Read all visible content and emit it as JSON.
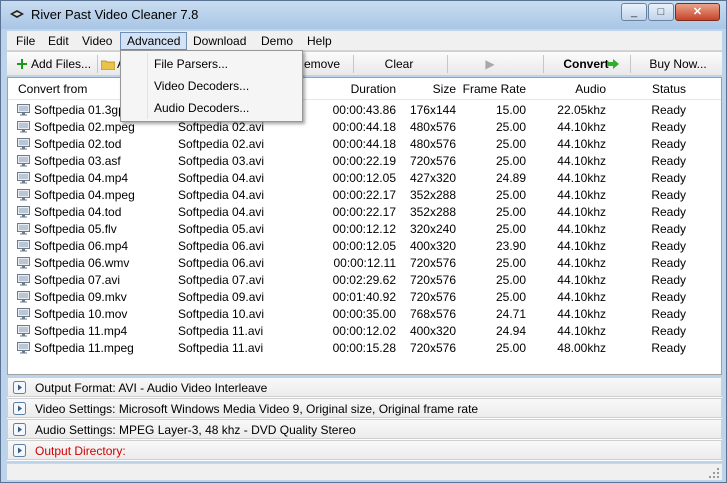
{
  "window": {
    "title": "River Past Video Cleaner 7.8"
  },
  "window_controls": {
    "minimize": "_",
    "maximize": "□",
    "close": "✕"
  },
  "menu": [
    "File",
    "Edit",
    "Video",
    "Advanced",
    "Download",
    "Demo",
    "Help"
  ],
  "advanced_menu": [
    "File Parsers...",
    "Video Decoders...",
    "Audio Decoders..."
  ],
  "toolbar": {
    "add_files": "Add Files...",
    "add_folder": "A",
    "remove": "emove",
    "clear": "Clear",
    "play": "▶",
    "convert": "Convert",
    "buy_now": "Buy Now..."
  },
  "columns": {
    "convert_from": "Convert from",
    "duration": "Duration",
    "size": "Size",
    "frame_rate": "Frame Rate",
    "audio": "Audio",
    "status": "Status"
  },
  "rows": [
    {
      "from": "Softpedia 01.3gp",
      "to": "Softpedia 01.avi",
      "duration": "00:00:43.86",
      "size": "176x144",
      "fps": "15.00",
      "audio": "22.05khz",
      "status": "Ready"
    },
    {
      "from": "Softpedia 02.mpeg",
      "to": "Softpedia 02.avi",
      "duration": "00:00:44.18",
      "size": "480x576",
      "fps": "25.00",
      "audio": "44.10khz",
      "status": "Ready"
    },
    {
      "from": "Softpedia 02.tod",
      "to": "Softpedia 02.avi",
      "duration": "00:00:44.18",
      "size": "480x576",
      "fps": "25.00",
      "audio": "44.10khz",
      "status": "Ready"
    },
    {
      "from": "Softpedia 03.asf",
      "to": "Softpedia 03.avi",
      "duration": "00:00:22.19",
      "size": "720x576",
      "fps": "25.00",
      "audio": "44.10khz",
      "status": "Ready"
    },
    {
      "from": "Softpedia 04.mp4",
      "to": "Softpedia 04.avi",
      "duration": "00:00:12.05",
      "size": "427x320",
      "fps": "24.89",
      "audio": "44.10khz",
      "status": "Ready"
    },
    {
      "from": "Softpedia 04.mpeg",
      "to": "Softpedia 04.avi",
      "duration": "00:00:22.17",
      "size": "352x288",
      "fps": "25.00",
      "audio": "44.10khz",
      "status": "Ready"
    },
    {
      "from": "Softpedia 04.tod",
      "to": "Softpedia 04.avi",
      "duration": "00:00:22.17",
      "size": "352x288",
      "fps": "25.00",
      "audio": "44.10khz",
      "status": "Ready"
    },
    {
      "from": "Softpedia 05.flv",
      "to": "Softpedia 05.avi",
      "duration": "00:00:12.12",
      "size": "320x240",
      "fps": "25.00",
      "audio": "44.10khz",
      "status": "Ready"
    },
    {
      "from": "Softpedia 06.mp4",
      "to": "Softpedia 06.avi",
      "duration": "00:00:12.05",
      "size": "400x320",
      "fps": "23.90",
      "audio": "44.10khz",
      "status": "Ready"
    },
    {
      "from": "Softpedia 06.wmv",
      "to": "Softpedia 06.avi",
      "duration": "00:00:12.11",
      "size": "720x576",
      "fps": "25.00",
      "audio": "44.10khz",
      "status": "Ready"
    },
    {
      "from": "Softpedia 07.avi",
      "to": "Softpedia 07.avi",
      "duration": "00:02:29.62",
      "size": "720x576",
      "fps": "25.00",
      "audio": "44.10khz",
      "status": "Ready"
    },
    {
      "from": "Softpedia 09.mkv",
      "to": "Softpedia 09.avi",
      "duration": "00:01:40.92",
      "size": "720x576",
      "fps": "25.00",
      "audio": "44.10khz",
      "status": "Ready"
    },
    {
      "from": "Softpedia 10.mov",
      "to": "Softpedia 10.avi",
      "duration": "00:00:35.00",
      "size": "768x576",
      "fps": "24.71",
      "audio": "44.10khz",
      "status": "Ready"
    },
    {
      "from": "Softpedia 11.mp4",
      "to": "Softpedia 11.avi",
      "duration": "00:00:12.02",
      "size": "400x320",
      "fps": "24.94",
      "audio": "44.10khz",
      "status": "Ready"
    },
    {
      "from": "Softpedia 11.mpeg",
      "to": "Softpedia 11.avi",
      "duration": "00:00:15.28",
      "size": "720x576",
      "fps": "25.00",
      "audio": "48.00khz",
      "status": "Ready"
    }
  ],
  "settings": {
    "output_format": "Output Format: AVI - Audio Video Interleave",
    "video_settings": "Video Settings: Microsoft Windows Media Video 9, Original size, Original frame rate",
    "audio_settings": "Audio Settings: MPEG Layer-3, 48 khz - DVD Quality Stereo",
    "output_directory": "Output Directory:"
  },
  "colors": {
    "warning_red": "#d00000",
    "add_green": "#1a9a1a",
    "convert_green": "#2fae2f"
  },
  "icons": [
    "app-icon",
    "add-icon",
    "folder-icon",
    "play-icon",
    "convert-arrow-icon",
    "monitor-icon",
    "expand-icon",
    "resize-grip-icon"
  ]
}
